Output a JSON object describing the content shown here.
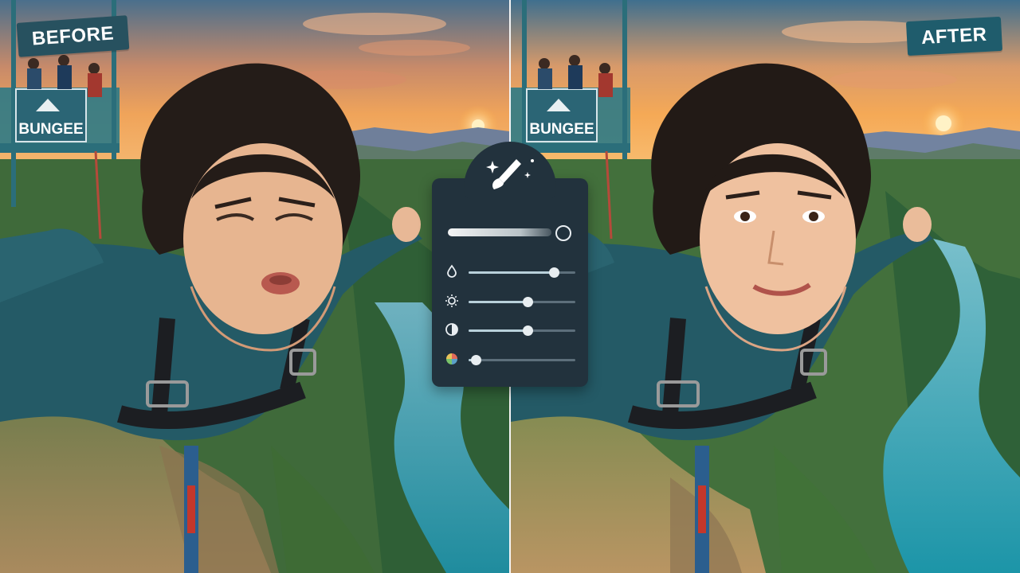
{
  "labels": {
    "before": "BEFORE",
    "after": "AFTER",
    "platform_sign": "BUNGEE"
  },
  "editor_panel": {
    "tool_icon": "magic-brush-icon",
    "brush_size_preview": "brush-stroke",
    "sliders": [
      {
        "icon": "droplet-icon",
        "level": 0.8
      },
      {
        "icon": "brightness-icon",
        "level": 0.55
      },
      {
        "icon": "contrast-icon",
        "level": 0.55
      },
      {
        "icon": "color-wheel-icon",
        "level": 0.07
      }
    ]
  },
  "colors": {
    "tag_background": "#27515f",
    "panel_background": "#22323d",
    "river": "#2a8fa0",
    "jacket": "#245a66"
  }
}
